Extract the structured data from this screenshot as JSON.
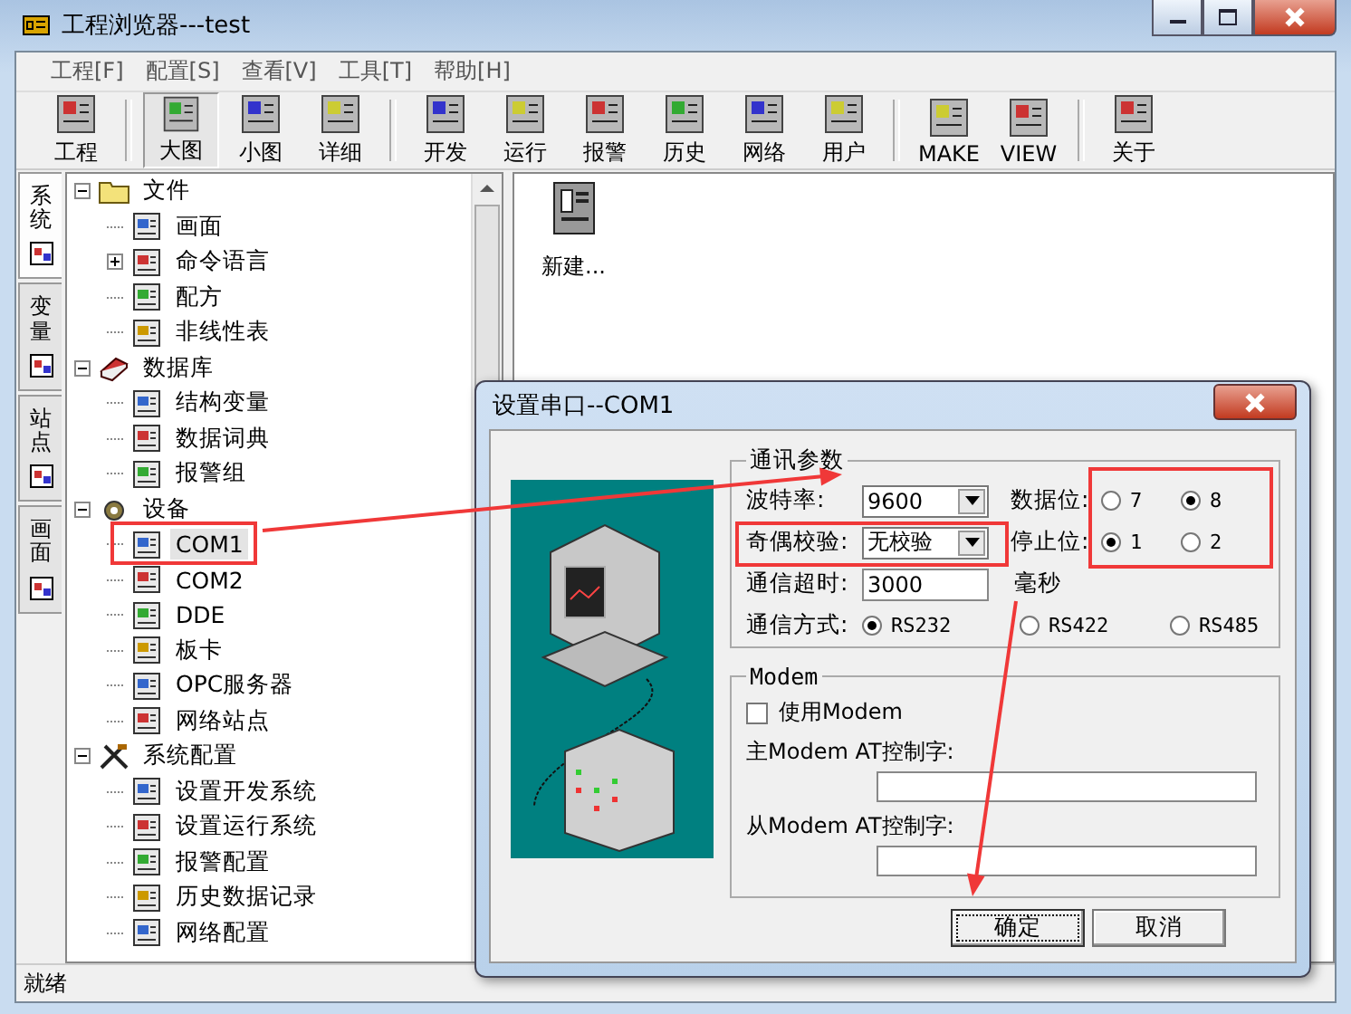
{
  "window": {
    "title": "工程浏览器---test"
  },
  "menu": [
    {
      "label": "工程[F]"
    },
    {
      "label": "配置[S]"
    },
    {
      "label": "查看[V]"
    },
    {
      "label": "工具[T]"
    },
    {
      "label": "帮助[H]"
    }
  ],
  "toolbar_groups": [
    {
      "buttons": [
        {
          "label": "工程",
          "selected": false
        }
      ]
    },
    {
      "buttons": [
        {
          "label": "大图",
          "selected": true
        },
        {
          "label": "小图",
          "selected": false
        },
        {
          "label": "详细",
          "selected": false
        }
      ]
    },
    {
      "buttons": [
        {
          "label": "开发",
          "selected": false
        },
        {
          "label": "运行",
          "selected": false
        },
        {
          "label": "报警",
          "selected": false
        },
        {
          "label": "历史",
          "selected": false
        },
        {
          "label": "网络",
          "selected": false
        },
        {
          "label": "用户",
          "selected": false
        }
      ]
    },
    {
      "buttons": [
        {
          "label": "MAKE",
          "selected": false
        },
        {
          "label": "VIEW",
          "selected": false
        }
      ]
    },
    {
      "buttons": [
        {
          "label": "关于",
          "selected": false
        }
      ]
    }
  ],
  "side_tabs": [
    {
      "label": "系统",
      "selected": true
    },
    {
      "label": "变量",
      "selected": false
    },
    {
      "label": "站点",
      "selected": false
    },
    {
      "label": "画面",
      "selected": false
    }
  ],
  "tree": [
    {
      "label": "文件",
      "kind": "folder",
      "expanded": true,
      "selected": false,
      "children": [
        {
          "label": "画面",
          "selected": false
        },
        {
          "label": "命令语言",
          "expanded": false,
          "selected": false
        },
        {
          "label": "配方",
          "selected": false
        },
        {
          "label": "非线性表",
          "selected": false
        }
      ]
    },
    {
      "label": "数据库",
      "kind": "database",
      "expanded": true,
      "selected": false,
      "children": [
        {
          "label": "结构变量",
          "selected": false
        },
        {
          "label": "数据词典",
          "selected": false
        },
        {
          "label": "报警组",
          "selected": false
        }
      ]
    },
    {
      "label": "设备",
      "kind": "device",
      "expanded": true,
      "selected": false,
      "children": [
        {
          "label": "COM1",
          "selected": true
        },
        {
          "label": "COM2",
          "selected": false
        },
        {
          "label": "DDE",
          "selected": false
        },
        {
          "label": "板卡",
          "selected": false
        },
        {
          "label": "OPC服务器",
          "selected": false
        },
        {
          "label": "网络站点",
          "selected": false
        }
      ]
    },
    {
      "label": "系统配置",
      "kind": "tools",
      "expanded": true,
      "selected": false,
      "children": [
        {
          "label": "设置开发系统",
          "selected": false
        },
        {
          "label": "设置运行系统",
          "selected": false
        },
        {
          "label": "报警配置",
          "selected": false
        },
        {
          "label": "历史数据记录",
          "selected": false
        },
        {
          "label": "网络配置",
          "selected": false
        }
      ]
    }
  ],
  "content_items": [
    {
      "label": "新建..."
    }
  ],
  "status_bar": {
    "text": "就绪"
  },
  "dialog": {
    "title": "设置串口--COM1",
    "comm_group": {
      "title": "通讯参数",
      "baud": {
        "label": "波特率:",
        "value": "9600"
      },
      "parity": {
        "label": "奇偶校验:",
        "value": "无校验"
      },
      "data_bits": {
        "label": "数据位:",
        "options": [
          {
            "label": "7",
            "selected": false
          },
          {
            "label": "8",
            "selected": true
          }
        ]
      },
      "stop_bits": {
        "label": "停止位:",
        "options": [
          {
            "label": "1",
            "selected": true
          },
          {
            "label": "2",
            "selected": false
          }
        ]
      },
      "timeout": {
        "label": "通信超时:",
        "value": "3000",
        "unit": "毫秒"
      },
      "mode": {
        "label": "通信方式:",
        "options": [
          {
            "label": "RS232",
            "selected": true
          },
          {
            "label": "RS422",
            "selected": false
          },
          {
            "label": "RS485",
            "selected": false
          }
        ]
      }
    },
    "modem_group": {
      "title": "Modem",
      "use_modem": {
        "label": "使用Modem",
        "checked": false
      },
      "master_at": {
        "label": "主Modem AT控制字:"
      },
      "slave_at": {
        "label": "从Modem AT控制字:"
      }
    },
    "buttons": [
      {
        "label": "确定",
        "focused": true
      },
      {
        "label": "取消",
        "focused": false
      }
    ]
  }
}
